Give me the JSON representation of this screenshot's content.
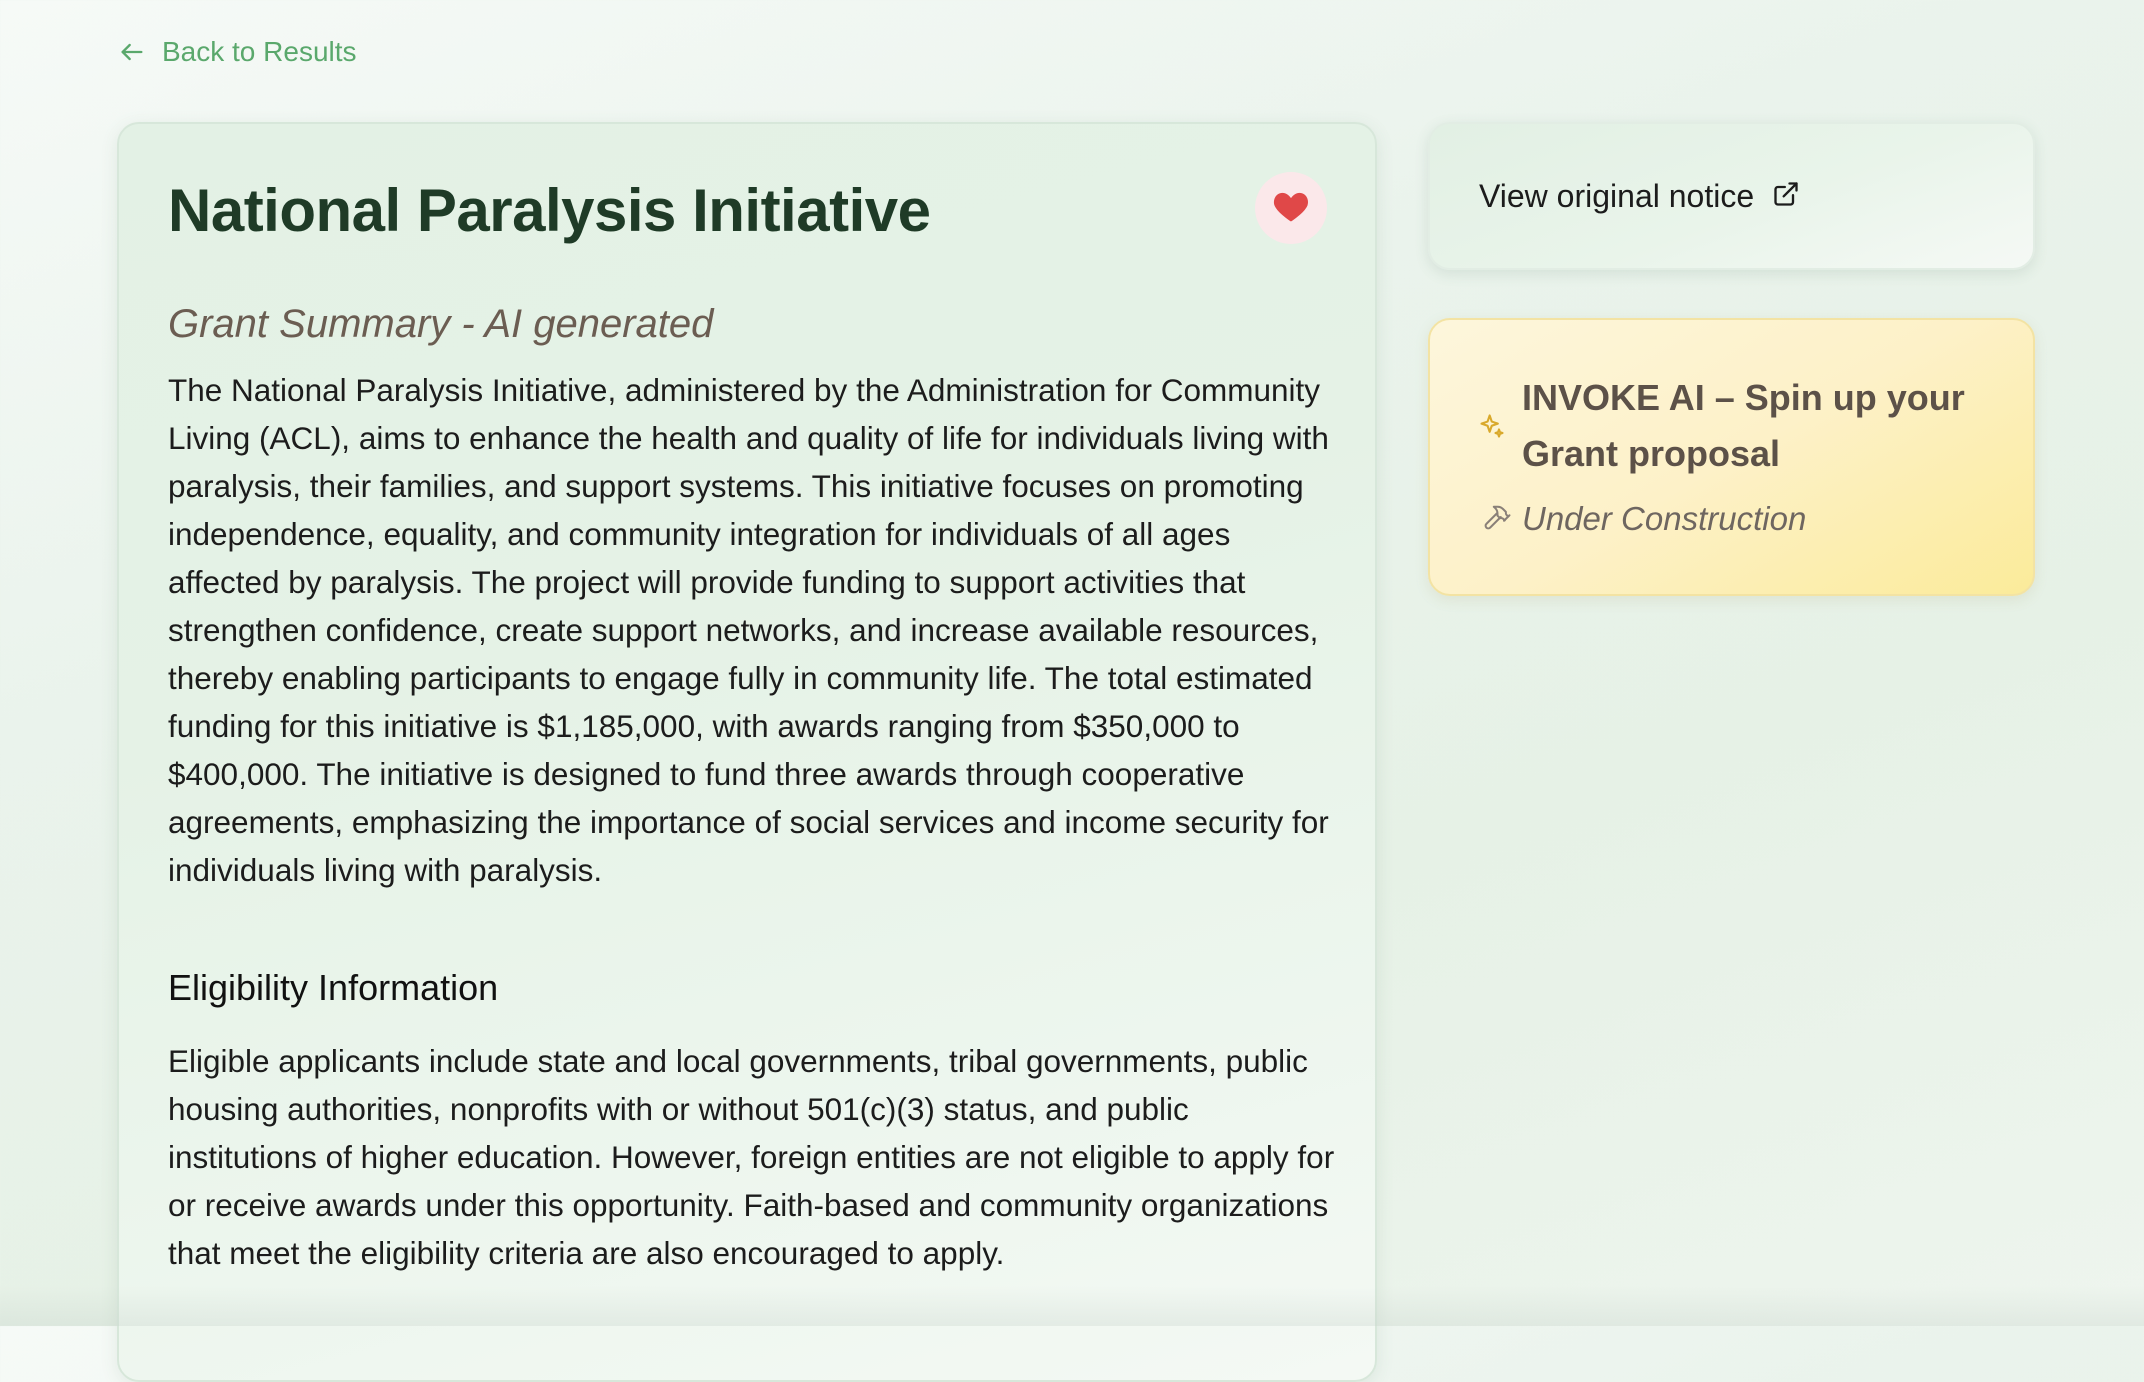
{
  "nav": {
    "back_label": "Back to Results"
  },
  "grant": {
    "title": "National Paralysis Initiative",
    "favorited": true,
    "summary_heading": "Grant Summary - AI generated",
    "summary_text": "The National Paralysis Initiative, administered by the Administration for Community Living (ACL), aims to enhance the health and quality of life for individuals living with paralysis, their families, and support systems. This initiative focuses on promoting independence, equality, and community integration for individuals of all ages affected by paralysis. The project will provide funding to support activities that strengthen confidence, create support networks, and increase available resources, thereby enabling participants to engage fully in community life. The total estimated funding for this initiative is $1,185,000, with awards ranging from $350,000 to $400,000. The initiative is designed to fund three awards through cooperative agreements, emphasizing the importance of social services and income security for individuals living with paralysis.",
    "eligibility_heading": "Eligibility Information",
    "eligibility_text": "Eligible applicants include state and local governments, tribal governments, public housing authorities, nonprofits with or without 501(c)(3) status, and public institutions of higher education. However, foreign entities are not eligible to apply for or receive awards under this opportunity. Faith-based and community organizations that meet the eligibility criteria are also encouraged to apply."
  },
  "sidebar": {
    "notice_label": "View original notice",
    "ai_title": "INVOKE AI – Spin up your Grant proposal",
    "ai_status": "Under Construction"
  },
  "icons": {
    "back": "arrow-left-icon",
    "favorite": "heart-icon",
    "external": "external-link-icon",
    "ai": "sparkles-icon",
    "status": "hammer-icon"
  },
  "colors": {
    "accent_green": "#5aa86c",
    "title_green": "#1f3b27",
    "heart_red": "#e04848",
    "ai_card_yellow": "#fbeb9a"
  }
}
